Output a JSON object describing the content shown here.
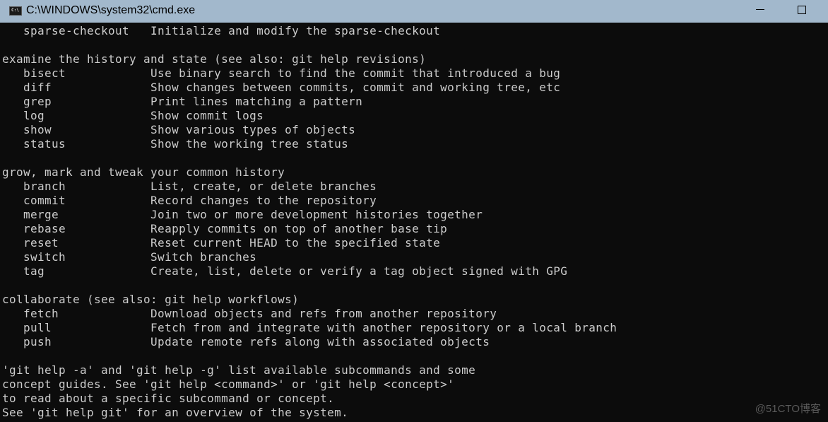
{
  "window": {
    "title": "C:\\WINDOWS\\system32\\cmd.exe",
    "icon": "cmd-icon",
    "icon_text": "C:\\"
  },
  "console": {
    "lines": [
      "   sparse-checkout   Initialize and modify the sparse-checkout",
      "",
      "examine the history and state (see also: git help revisions)",
      "   bisect            Use binary search to find the commit that introduced a bug",
      "   diff              Show changes between commits, commit and working tree, etc",
      "   grep              Print lines matching a pattern",
      "   log               Show commit logs",
      "   show              Show various types of objects",
      "   status            Show the working tree status",
      "",
      "grow, mark and tweak your common history",
      "   branch            List, create, or delete branches",
      "   commit            Record changes to the repository",
      "   merge             Join two or more development histories together",
      "   rebase            Reapply commits on top of another base tip",
      "   reset             Reset current HEAD to the specified state",
      "   switch            Switch branches",
      "   tag               Create, list, delete or verify a tag object signed with GPG",
      "",
      "collaborate (see also: git help workflows)",
      "   fetch             Download objects and refs from another repository",
      "   pull              Fetch from and integrate with another repository or a local branch",
      "   push              Update remote refs along with associated objects",
      "",
      "'git help -a' and 'git help -g' list available subcommands and some",
      "concept guides. See 'git help <command>' or 'git help <concept>'",
      "to read about a specific subcommand or concept.",
      "See 'git help git' for an overview of the system."
    ]
  },
  "watermark": "@51CTO博客"
}
